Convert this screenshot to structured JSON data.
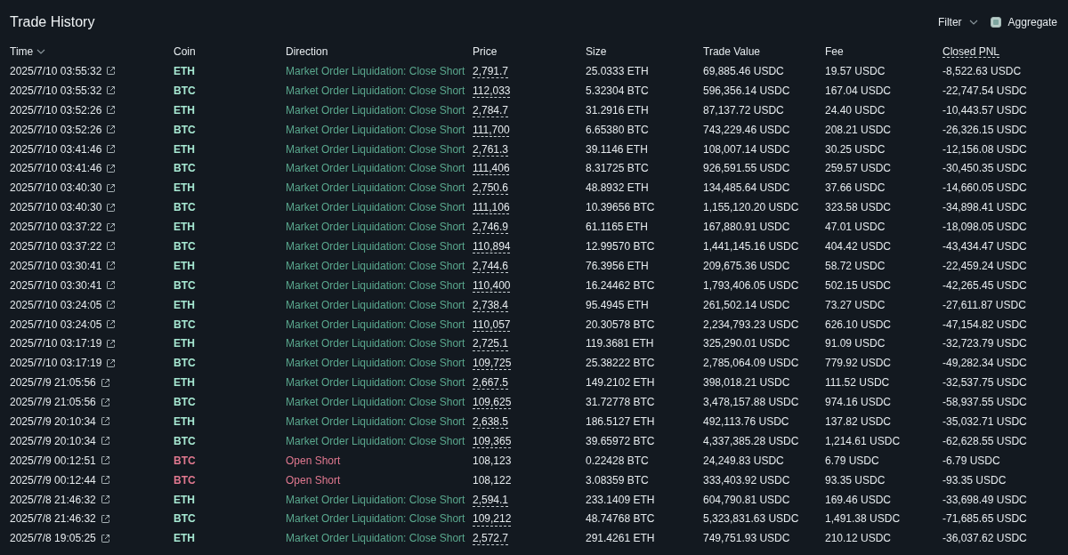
{
  "title": "Trade History",
  "filter": {
    "label": "Filter"
  },
  "aggregate": {
    "label": "Aggregate",
    "checked": true
  },
  "columns": [
    {
      "label": "Time",
      "sorted": true,
      "dashed": false
    },
    {
      "label": "Coin",
      "sorted": false,
      "dashed": false
    },
    {
      "label": "Direction",
      "sorted": false,
      "dashed": false
    },
    {
      "label": "Price",
      "sorted": false,
      "dashed": false
    },
    {
      "label": "Size",
      "sorted": false,
      "dashed": false
    },
    {
      "label": "Trade Value",
      "sorted": false,
      "dashed": false
    },
    {
      "label": "Fee",
      "sorted": false,
      "dashed": false
    },
    {
      "label": "Closed PNL",
      "sorted": false,
      "dashed": true
    }
  ],
  "rows": [
    {
      "time": "2025/7/10 03:55:32",
      "coin": "ETH",
      "direction": "Market Order Liquidation: Close Short",
      "kind": "close",
      "price": "2,791.7",
      "size": "25.0333 ETH",
      "value": "69,885.46 USDC",
      "fee": "19.57 USDC",
      "pnl": "-8,522.63 USDC"
    },
    {
      "time": "2025/7/10 03:55:32",
      "coin": "BTC",
      "direction": "Market Order Liquidation: Close Short",
      "kind": "close",
      "price": "112,033",
      "size": "5.32304 BTC",
      "value": "596,356.14 USDC",
      "fee": "167.04 USDC",
      "pnl": "-22,747.54 USDC"
    },
    {
      "time": "2025/7/10 03:52:26",
      "coin": "ETH",
      "direction": "Market Order Liquidation: Close Short",
      "kind": "close",
      "price": "2,784.7",
      "size": "31.2916 ETH",
      "value": "87,137.72 USDC",
      "fee": "24.40 USDC",
      "pnl": "-10,443.57 USDC"
    },
    {
      "time": "2025/7/10 03:52:26",
      "coin": "BTC",
      "direction": "Market Order Liquidation: Close Short",
      "kind": "close",
      "price": "111,700",
      "size": "6.65380 BTC",
      "value": "743,229.46 USDC",
      "fee": "208.21 USDC",
      "pnl": "-26,326.15 USDC"
    },
    {
      "time": "2025/7/10 03:41:46",
      "coin": "ETH",
      "direction": "Market Order Liquidation: Close Short",
      "kind": "close",
      "price": "2,761.3",
      "size": "39.1146 ETH",
      "value": "108,007.14 USDC",
      "fee": "30.25 USDC",
      "pnl": "-12,156.08 USDC"
    },
    {
      "time": "2025/7/10 03:41:46",
      "coin": "BTC",
      "direction": "Market Order Liquidation: Close Short",
      "kind": "close",
      "price": "111,406",
      "size": "8.31725 BTC",
      "value": "926,591.55 USDC",
      "fee": "259.57 USDC",
      "pnl": "-30,450.35 USDC"
    },
    {
      "time": "2025/7/10 03:40:30",
      "coin": "ETH",
      "direction": "Market Order Liquidation: Close Short",
      "kind": "close",
      "price": "2,750.6",
      "size": "48.8932 ETH",
      "value": "134,485.64 USDC",
      "fee": "37.66 USDC",
      "pnl": "-14,660.05 USDC"
    },
    {
      "time": "2025/7/10 03:40:30",
      "coin": "BTC",
      "direction": "Market Order Liquidation: Close Short",
      "kind": "close",
      "price": "111,106",
      "size": "10.39656 BTC",
      "value": "1,155,120.20 USDC",
      "fee": "323.58 USDC",
      "pnl": "-34,898.41 USDC"
    },
    {
      "time": "2025/7/10 03:37:22",
      "coin": "ETH",
      "direction": "Market Order Liquidation: Close Short",
      "kind": "close",
      "price": "2,746.9",
      "size": "61.1165 ETH",
      "value": "167,880.91 USDC",
      "fee": "47.01 USDC",
      "pnl": "-18,098.05 USDC"
    },
    {
      "time": "2025/7/10 03:37:22",
      "coin": "BTC",
      "direction": "Market Order Liquidation: Close Short",
      "kind": "close",
      "price": "110,894",
      "size": "12.99570 BTC",
      "value": "1,441,145.16 USDC",
      "fee": "404.42 USDC",
      "pnl": "-43,434.47 USDC"
    },
    {
      "time": "2025/7/10 03:30:41",
      "coin": "ETH",
      "direction": "Market Order Liquidation: Close Short",
      "kind": "close",
      "price": "2,744.6",
      "size": "76.3956 ETH",
      "value": "209,675.36 USDC",
      "fee": "58.72 USDC",
      "pnl": "-22,459.24 USDC"
    },
    {
      "time": "2025/7/10 03:30:41",
      "coin": "BTC",
      "direction": "Market Order Liquidation: Close Short",
      "kind": "close",
      "price": "110,400",
      "size": "16.24462 BTC",
      "value": "1,793,406.05 USDC",
      "fee": "502.15 USDC",
      "pnl": "-42,265.45 USDC"
    },
    {
      "time": "2025/7/10 03:24:05",
      "coin": "ETH",
      "direction": "Market Order Liquidation: Close Short",
      "kind": "close",
      "price": "2,738.4",
      "size": "95.4945 ETH",
      "value": "261,502.14 USDC",
      "fee": "73.27 USDC",
      "pnl": "-27,611.87 USDC"
    },
    {
      "time": "2025/7/10 03:24:05",
      "coin": "BTC",
      "direction": "Market Order Liquidation: Close Short",
      "kind": "close",
      "price": "110,057",
      "size": "20.30578 BTC",
      "value": "2,234,793.23 USDC",
      "fee": "626.10 USDC",
      "pnl": "-47,154.82 USDC"
    },
    {
      "time": "2025/7/10 03:17:19",
      "coin": "ETH",
      "direction": "Market Order Liquidation: Close Short",
      "kind": "close",
      "price": "2,725.1",
      "size": "119.3681 ETH",
      "value": "325,290.01 USDC",
      "fee": "91.09 USDC",
      "pnl": "-32,723.79 USDC"
    },
    {
      "time": "2025/7/10 03:17:19",
      "coin": "BTC",
      "direction": "Market Order Liquidation: Close Short",
      "kind": "close",
      "price": "109,725",
      "size": "25.38222 BTC",
      "value": "2,785,064.09 USDC",
      "fee": "779.92 USDC",
      "pnl": "-49,282.34 USDC"
    },
    {
      "time": "2025/7/9 21:05:56",
      "coin": "ETH",
      "direction": "Market Order Liquidation: Close Short",
      "kind": "close",
      "price": "2,667.5",
      "size": "149.2102 ETH",
      "value": "398,018.21 USDC",
      "fee": "111.52 USDC",
      "pnl": "-32,537.75 USDC"
    },
    {
      "time": "2025/7/9 21:05:56",
      "coin": "BTC",
      "direction": "Market Order Liquidation: Close Short",
      "kind": "close",
      "price": "109,625",
      "size": "31.72778 BTC",
      "value": "3,478,157.88 USDC",
      "fee": "974.16 USDC",
      "pnl": "-58,937.55 USDC"
    },
    {
      "time": "2025/7/9 20:10:34",
      "coin": "ETH",
      "direction": "Market Order Liquidation: Close Short",
      "kind": "close",
      "price": "2,638.5",
      "size": "186.5127 ETH",
      "value": "492,113.76 USDC",
      "fee": "137.82 USDC",
      "pnl": "-35,032.71 USDC"
    },
    {
      "time": "2025/7/9 20:10:34",
      "coin": "BTC",
      "direction": "Market Order Liquidation: Close Short",
      "kind": "close",
      "price": "109,365",
      "size": "39.65972 BTC",
      "value": "4,337,385.28 USDC",
      "fee": "1,214.61 USDC",
      "pnl": "-62,628.55 USDC"
    },
    {
      "time": "2025/7/9 00:12:51",
      "coin": "BTC",
      "direction": "Open Short",
      "kind": "open",
      "price": "108,123",
      "size": "0.22428 BTC",
      "value": "24,249.83 USDC",
      "fee": "6.79 USDC",
      "pnl": "-6.79 USDC"
    },
    {
      "time": "2025/7/9 00:12:44",
      "coin": "BTC",
      "direction": "Open Short",
      "kind": "open",
      "price": "108,122",
      "size": "3.08359 BTC",
      "value": "333,403.92 USDC",
      "fee": "93.35 USDC",
      "pnl": "-93.35 USDC"
    },
    {
      "time": "2025/7/8 21:46:32",
      "coin": "ETH",
      "direction": "Market Order Liquidation: Close Short",
      "kind": "close",
      "price": "2,594.1",
      "size": "233.1409 ETH",
      "value": "604,790.81 USDC",
      "fee": "169.46 USDC",
      "pnl": "-33,698.49 USDC"
    },
    {
      "time": "2025/7/8 21:46:32",
      "coin": "BTC",
      "direction": "Market Order Liquidation: Close Short",
      "kind": "close",
      "price": "109,212",
      "size": "48.74768 BTC",
      "value": "5,323,831.63 USDC",
      "fee": "1,491.38 USDC",
      "pnl": "-71,685.65 USDC"
    },
    {
      "time": "2025/7/8 19:05:25",
      "coin": "ETH",
      "direction": "Market Order Liquidation: Close Short",
      "kind": "close",
      "price": "2,572.7",
      "size": "291.4261 ETH",
      "value": "749,751.93 USDC",
      "fee": "210.12 USDC",
      "pnl": "-36,037.62 USDC"
    }
  ]
}
